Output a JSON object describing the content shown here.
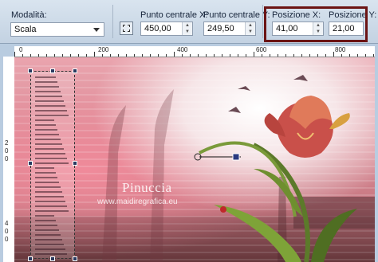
{
  "toolbar": {
    "mode_label": "Modalità:",
    "mode_value": "Scala",
    "center_x_label": "Punto centrale X:",
    "center_x_value": "450,00",
    "center_y_label": "Punto centrale Y:",
    "center_y_value": "249,50",
    "pos_x_label": "Posizione X:",
    "pos_x_value": "41,00",
    "pos_y_label": "Posizione Y:",
    "pos_y_value": "21,00"
  },
  "ruler": {
    "top_labels": [
      "0",
      "200",
      "400",
      "600",
      "800"
    ],
    "left_labels": [
      "2",
      "0",
      "0",
      "4",
      "0",
      "0"
    ]
  },
  "canvas": {
    "watermark_title": "Pinuccia",
    "watermark_url": "www.maidiregrafica.eu"
  },
  "colors": {
    "highlight_border": "#6b1414",
    "toolbar_bg": "#d3dfeb"
  }
}
